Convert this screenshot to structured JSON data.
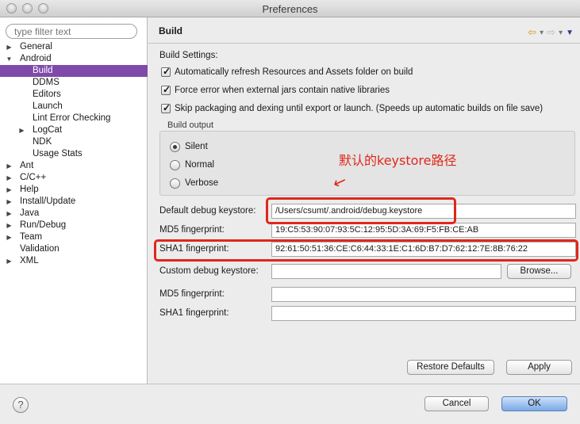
{
  "window": {
    "title": "Preferences"
  },
  "filter": {
    "placeholder": "type filter text"
  },
  "tree": [
    {
      "label": "General",
      "level": 0,
      "arrow": "▶"
    },
    {
      "label": "Android",
      "level": 0,
      "arrow": "▼"
    },
    {
      "label": "Build",
      "level": 1,
      "arrow": "",
      "selected": true
    },
    {
      "label": "DDMS",
      "level": 1,
      "arrow": ""
    },
    {
      "label": "Editors",
      "level": 1,
      "arrow": ""
    },
    {
      "label": "Launch",
      "level": 1,
      "arrow": ""
    },
    {
      "label": "Lint Error Checking",
      "level": 1,
      "arrow": ""
    },
    {
      "label": "LogCat",
      "level": 1,
      "arrow": "▶"
    },
    {
      "label": "NDK",
      "level": 1,
      "arrow": ""
    },
    {
      "label": "Usage Stats",
      "level": 1,
      "arrow": ""
    },
    {
      "label": "Ant",
      "level": 0,
      "arrow": "▶"
    },
    {
      "label": "C/C++",
      "level": 0,
      "arrow": "▶"
    },
    {
      "label": "Help",
      "level": 0,
      "arrow": "▶"
    },
    {
      "label": "Install/Update",
      "level": 0,
      "arrow": "▶"
    },
    {
      "label": "Java",
      "level": 0,
      "arrow": "▶"
    },
    {
      "label": "Run/Debug",
      "level": 0,
      "arrow": "▶"
    },
    {
      "label": "Team",
      "level": 0,
      "arrow": "▶"
    },
    {
      "label": "Validation",
      "level": 0,
      "arrow": ""
    },
    {
      "label": "XML",
      "level": 0,
      "arrow": "▶"
    }
  ],
  "page": {
    "title": "Build",
    "settings_label": "Build Settings:",
    "checkboxes": [
      {
        "label": "Automatically refresh Resources and Assets folder on build",
        "checked": true
      },
      {
        "label": "Force error when external jars contain native libraries",
        "checked": true
      },
      {
        "label": "Skip packaging and dexing until export or launch. (Speeds up automatic builds on file save)",
        "checked": true
      }
    ],
    "build_output": {
      "title": "Build output",
      "options": [
        "Silent",
        "Normal",
        "Verbose"
      ],
      "selected": "Silent"
    },
    "annotation": "默认的keystore路径",
    "default_keystore": {
      "label": "Default debug keystore:",
      "value": "/Users/csumt/.android/debug.keystore"
    },
    "md5": {
      "label": "MD5 fingerprint:",
      "value": "19:C5:53:90:07:93:5C:12:95:5D:3A:69:F5:FB:CE:AB"
    },
    "sha1": {
      "label": "SHA1 fingerprint:",
      "value": "92:61:50:51:36:CE:C6:44:33:1E:C1:6D:B7:D7:62:12:7E:8B:76:22"
    },
    "custom_keystore": {
      "label": "Custom debug keystore:",
      "value": ""
    },
    "custom_md5": {
      "label": "MD5 fingerprint:",
      "value": ""
    },
    "custom_sha1": {
      "label": "SHA1 fingerprint:",
      "value": ""
    },
    "browse_label": "Browse...",
    "restore_label": "Restore Defaults",
    "apply_label": "Apply"
  },
  "footer": {
    "help_label": "?",
    "cancel_label": "Cancel",
    "ok_label": "OK"
  },
  "colors": {
    "selection": "#7f4aa9",
    "highlight": "#e0271b",
    "ok_button": "#79a9e6"
  }
}
